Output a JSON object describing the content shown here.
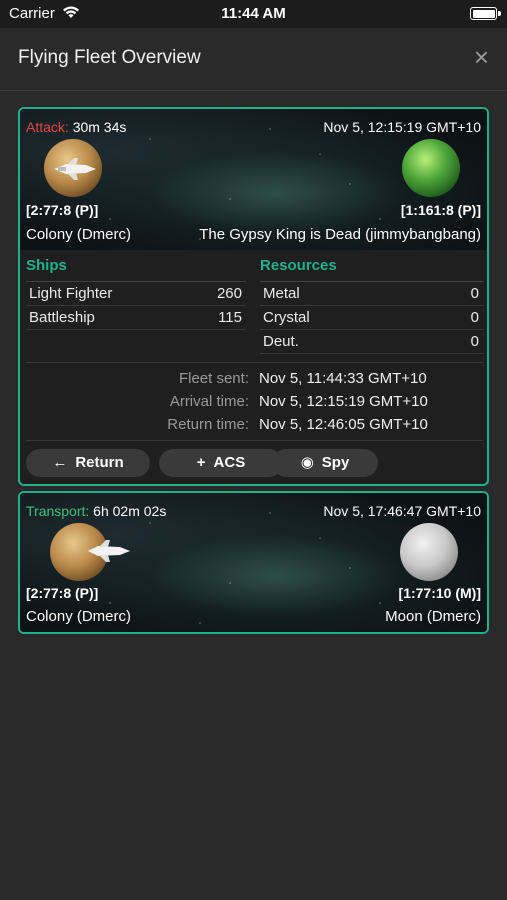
{
  "status_bar": {
    "carrier": "Carrier",
    "time": "11:44 AM"
  },
  "modal": {
    "title": "Flying Fleet Overview",
    "close_label": "×"
  },
  "fleets": [
    {
      "mission_type": "Attack:",
      "mission_color": "#e2473f",
      "countdown": "30m 34s",
      "arrival": "Nov 5, 12:15:19 GMT+10",
      "origin": {
        "coords": "[2:77:8 (P)]",
        "name": "Colony (Dmerc)"
      },
      "target": {
        "coords": "[1:161:8 (P)]",
        "name": "The Gypsy King is Dead (jimmybangbang)"
      },
      "ships_header": "Ships",
      "resources_header": "Resources",
      "ships": [
        {
          "name": "Light Fighter",
          "count": "260"
        },
        {
          "name": "Battleship",
          "count": "115"
        }
      ],
      "resources": [
        {
          "name": "Metal",
          "amount": "0"
        },
        {
          "name": "Crystal",
          "amount": "0"
        },
        {
          "name": "Deut.",
          "amount": "0"
        }
      ],
      "times": [
        {
          "label": "Fleet sent:",
          "value": "Nov 5, 11:44:33 GMT+10"
        },
        {
          "label": "Arrival time:",
          "value": "Nov 5, 12:15:19 GMT+10"
        },
        {
          "label": "Return time:",
          "value": "Nov 5, 12:46:05 GMT+10"
        }
      ],
      "actions": [
        {
          "icon": "←",
          "label": "Return"
        },
        {
          "icon": "+",
          "label": "ACS"
        },
        {
          "icon": "◉",
          "label": "Spy"
        }
      ]
    },
    {
      "mission_type": "Transport:",
      "mission_color": "#3fc47a",
      "countdown": "6h 02m 02s",
      "arrival": "Nov 5, 17:46:47 GMT+10",
      "origin": {
        "coords": "[2:77:8 (P)]",
        "name": "Colony (Dmerc)"
      },
      "target": {
        "coords": "[1:77:10 (M)]",
        "name": "Moon (Dmerc)"
      }
    }
  ],
  "colors": {
    "accent": "#1fb28a",
    "background": "#2a2a2a"
  }
}
